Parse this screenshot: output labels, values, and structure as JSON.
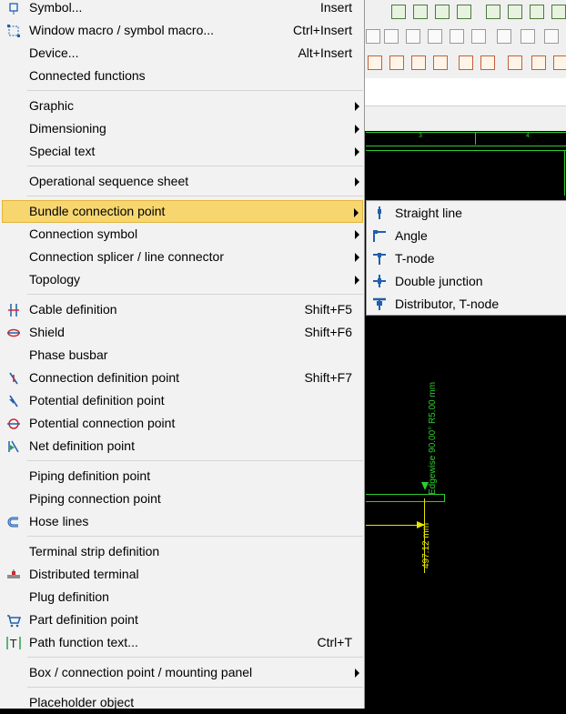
{
  "menu": {
    "items": [
      {
        "label": "Symbol...",
        "shortcut": "Insert",
        "icon": "symbol-icon"
      },
      {
        "label": "Window macro / symbol macro...",
        "shortcut": "Ctrl+Insert",
        "icon": "window-macro-icon"
      },
      {
        "label": "Device...",
        "shortcut": "Alt+Insert"
      },
      {
        "label": "Connected functions"
      },
      {
        "label": "Graphic"
      },
      {
        "label": "Dimensioning"
      },
      {
        "label": "Special text"
      },
      {
        "label": "Operational sequence sheet"
      },
      {
        "label": "Bundle connection point"
      },
      {
        "label": "Connection symbol"
      },
      {
        "label": "Connection splicer / line connector"
      },
      {
        "label": "Topology"
      },
      {
        "label": "Cable definition",
        "shortcut": "Shift+F5",
        "icon": "cable-definition-icon"
      },
      {
        "label": "Shield",
        "shortcut": "Shift+F6",
        "icon": "shield-icon"
      },
      {
        "label": "Phase busbar"
      },
      {
        "label": "Connection definition point",
        "shortcut": "Shift+F7",
        "icon": "connection-definition-point-icon"
      },
      {
        "label": "Potential definition point",
        "icon": "potential-definition-point-icon"
      },
      {
        "label": "Potential connection point",
        "icon": "potential-connection-point-icon"
      },
      {
        "label": "Net definition point",
        "icon": "net-definition-point-icon"
      },
      {
        "label": "Piping definition point"
      },
      {
        "label": "Piping connection point"
      },
      {
        "label": "Hose lines",
        "icon": "hose-lines-icon"
      },
      {
        "label": "Terminal strip definition"
      },
      {
        "label": "Distributed terminal",
        "icon": "distributed-terminal-icon"
      },
      {
        "label": "Plug definition"
      },
      {
        "label": "Part definition point",
        "icon": "part-definition-point-icon"
      },
      {
        "label": "Path function text...",
        "shortcut": "Ctrl+T",
        "icon": "path-function-text-icon"
      },
      {
        "label": "Box / connection point / mounting panel"
      },
      {
        "label": "Placeholder object"
      }
    ]
  },
  "submenu": {
    "items": [
      {
        "label": "Straight line",
        "icon": "straight-line-icon"
      },
      {
        "label": "Angle",
        "icon": "angle-icon"
      },
      {
        "label": "T-node",
        "icon": "t-node-icon"
      },
      {
        "label": "Double junction",
        "icon": "double-junction-icon"
      },
      {
        "label": "Distributor, T-node",
        "icon": "distributor-t-node-icon"
      }
    ]
  },
  "canvas": {
    "column_numbers": [
      "3",
      "4"
    ],
    "dimension_green": "Edgewise 90.00° R5.00 mm",
    "dimension_yellow": "497.12 mm"
  },
  "colors": {
    "menu_bg": "#f2f2f2",
    "highlight": "#f7d670",
    "highlight_border": "#e2b43b",
    "canvas_bg": "#000000",
    "grid_green": "#2ecc2e",
    "dim_yellow": "#e6e600",
    "icon_blue": "#1f5fb0"
  }
}
